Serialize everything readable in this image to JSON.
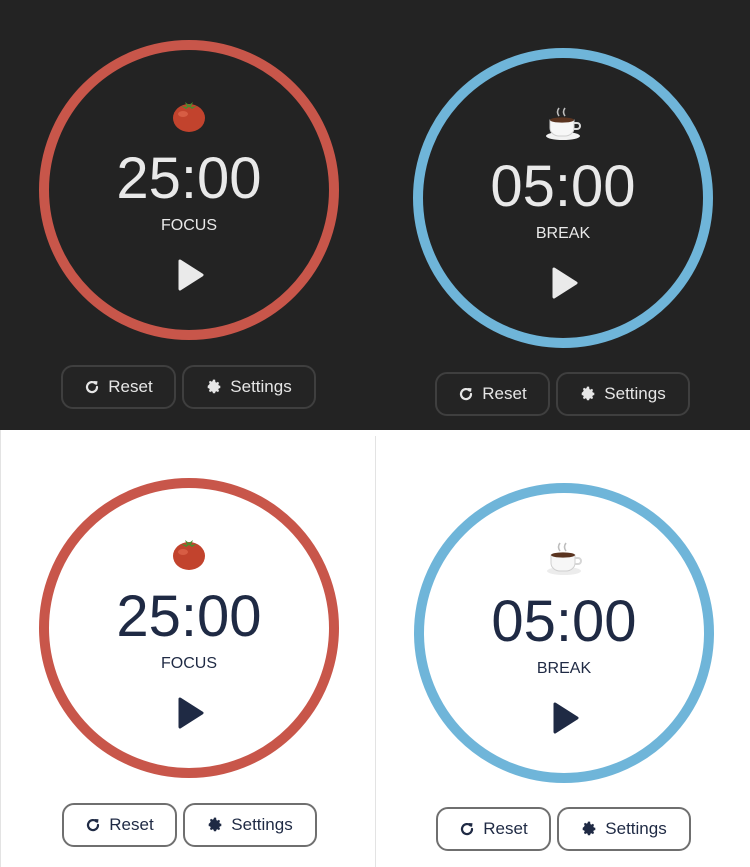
{
  "timers": [
    {
      "theme": "dark",
      "mode": "focus",
      "emoji": "🍅",
      "time": "25:00",
      "label": "FOCUS",
      "reset_label": "Reset",
      "settings_label": "Settings",
      "ring_color": "#c8564a",
      "icons": {
        "emoji": "tomato-icon",
        "play": "play-icon",
        "reset": "refresh-icon",
        "settings": "gear-icon"
      }
    },
    {
      "theme": "dark",
      "mode": "break",
      "emoji": "☕",
      "time": "05:00",
      "label": "BREAK",
      "reset_label": "Reset",
      "settings_label": "Settings",
      "ring_color": "#6fb5d9",
      "icons": {
        "emoji": "coffee-cup-icon",
        "play": "play-icon",
        "reset": "refresh-icon",
        "settings": "gear-icon"
      }
    },
    {
      "theme": "light",
      "mode": "focus",
      "emoji": "🍅",
      "time": "25:00",
      "label": "FOCUS",
      "reset_label": "Reset",
      "settings_label": "Settings",
      "ring_color": "#c8564a",
      "icons": {
        "emoji": "tomato-icon",
        "play": "play-icon",
        "reset": "refresh-icon",
        "settings": "gear-icon"
      }
    },
    {
      "theme": "light",
      "mode": "break",
      "emoji": "☕",
      "time": "05:00",
      "label": "BREAK",
      "reset_label": "Reset",
      "settings_label": "Settings",
      "ring_color": "#6fb5d9",
      "icons": {
        "emoji": "coffee-cup-icon",
        "play": "play-icon",
        "reset": "refresh-icon",
        "settings": "gear-icon"
      }
    }
  ],
  "colors": {
    "dark_bg": "#232323",
    "light_bg": "#ffffff",
    "focus_ring": "#c8564a",
    "break_ring": "#6fb5d9",
    "dark_text": "#e9e9e9",
    "light_text": "#1f2a44"
  }
}
